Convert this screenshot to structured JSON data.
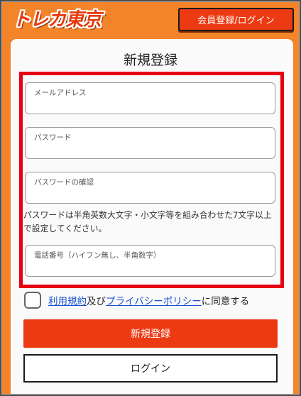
{
  "header": {
    "logo_text": "トレカ東京",
    "login_register_label": "会員登録/ログイン"
  },
  "form": {
    "title": "新規登録",
    "email_placeholder": "メールアドレス",
    "password_placeholder": "パスワード",
    "password_confirm_placeholder": "パスワードの確認",
    "password_hint": "パスワードは半角英数大文字・小文字等を組み合わせた7文字以上で設定してください。",
    "phone_placeholder": "電話番号（ハイフン無し、半角数字）",
    "terms_link": "利用規約",
    "conj": "及び",
    "privacy_link": "プライバシーポリシー",
    "agree_suffix": "に同意する",
    "register_button": "新規登録",
    "login_button": "ログイン"
  },
  "colors": {
    "brand_orange": "#f4842a",
    "accent_red": "#ec3a12",
    "highlight_red": "#e60012",
    "link_blue": "#1a4fd0"
  }
}
